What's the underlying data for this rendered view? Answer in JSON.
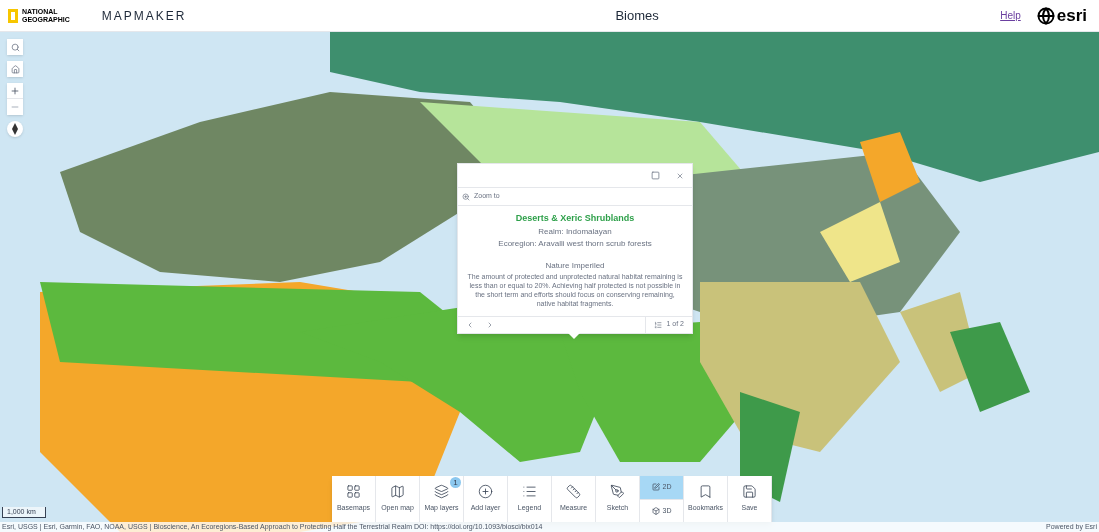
{
  "header": {
    "brand_top": "NATIONAL",
    "brand_bottom": "GEOGRAPHIC",
    "app_name": "MAPMAKER",
    "title": "Biomes",
    "help_link": "Help",
    "partner_logo": "esri"
  },
  "popup": {
    "zoom_action": "Zoom to",
    "heading": "Deserts & Xeric Shrublands",
    "realm": "Realm: Indomalayan",
    "ecoregion": "Ecoregion: Aravalli west thorn scrub forests",
    "status_title": "Nature Imperiled",
    "status_text": "The amount of protected and unprotected natural habitat remaining is less than or equal to 20%. Achieving half protected is not possible in the short term and efforts should focus on conserving remaining, native habitat fragments.",
    "pager": "1 of 2"
  },
  "toolbar": [
    {
      "kind": "tool",
      "label": "Basemaps"
    },
    {
      "kind": "tool",
      "label": "Open map"
    },
    {
      "kind": "tool",
      "label": "Map layers",
      "badge": "1"
    },
    {
      "kind": "tool",
      "label": "Add layer"
    },
    {
      "kind": "tool",
      "label": "Legend"
    },
    {
      "kind": "tool",
      "label": "Measure"
    },
    {
      "kind": "tool",
      "label": "Sketch"
    },
    {
      "kind": "view_toggle",
      "options": [
        {
          "label": "2D",
          "selected": true
        },
        {
          "label": "3D",
          "selected": false
        }
      ]
    },
    {
      "kind": "tool",
      "label": "Bookmarks"
    },
    {
      "kind": "tool",
      "label": "Save"
    }
  ],
  "scale_bar": "1,000 km",
  "attribution": "Esri, USGS | Esri, Garmin, FAO, NOAA, USGS | Bioscience, An Ecoregions-Based Approach to Protecting Half the Terrestrial Realm DOI: https://doi.org/10.1093/biosci/bix014",
  "powered_by": "Powered by Esri"
}
